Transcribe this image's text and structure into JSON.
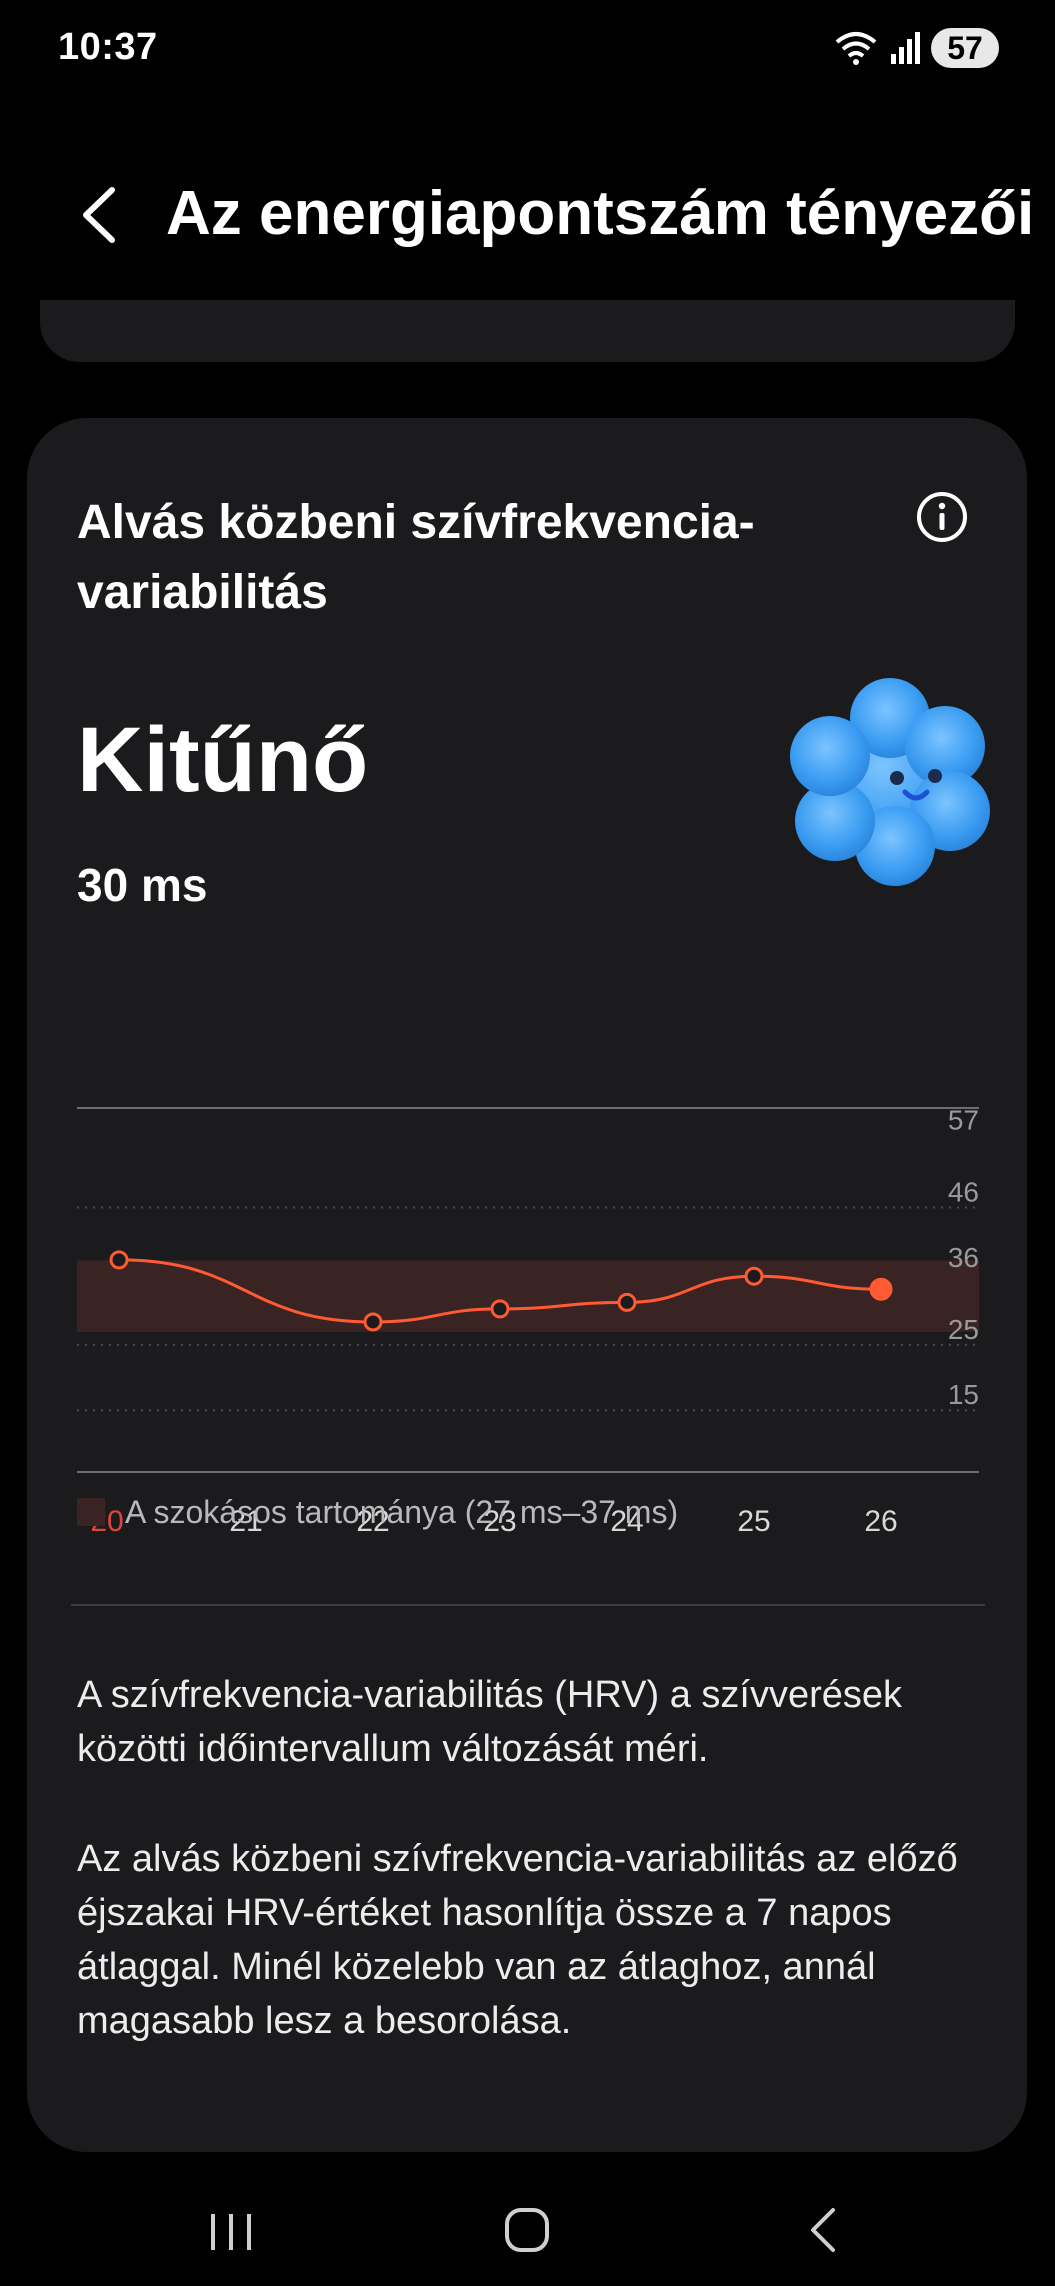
{
  "status": {
    "time": "10:37",
    "battery": "57",
    "icons": [
      "wifi-icon",
      "signal-icon",
      "battery-icon"
    ]
  },
  "header": {
    "title": "Az energiapontszám tényezői",
    "back_icon": "chevron-left-icon"
  },
  "card": {
    "title": "Alvás közbeni szívfrekvencia-variabilitás",
    "info_icon": "info-icon",
    "rating": "Kitűnő",
    "value": "30 ms",
    "mascot": "blue-fluffy-cloud-smiley"
  },
  "chart_data": {
    "type": "line",
    "x": [
      "20",
      "21",
      "22",
      "23",
      "24",
      "25",
      "26"
    ],
    "highlighted_x": "20",
    "series": [
      {
        "values": [
          38,
          null,
          28.5,
          30.5,
          31.5,
          35.5,
          33.5
        ]
      }
    ],
    "current_point_x": "26",
    "y_ticks": [
      57,
      46,
      36,
      25,
      15
    ],
    "normal_range": [
      27,
      37
    ],
    "legend": "A szokásos tartománya (27 ms–37 ms)",
    "colors": {
      "line": "#ff5a32",
      "band": "#3a2423",
      "highlight_label": "#e0443e"
    }
  },
  "description": {
    "p1": "A szívfrekvencia-variabilitás (HRV) a szívverések közötti időintervallum változását méri.",
    "p2": "Az alvás közbeni szívfrekvencia-variabilitás az előző éjszakai HRV-értéket hasonlítja össze a 7 napos átlaggal. Minél közelebb van az átlaghoz, annál magasabb lesz a besorolása."
  },
  "navbar": {
    "icons": [
      "recent-apps-icon",
      "home-icon",
      "back-icon"
    ]
  }
}
